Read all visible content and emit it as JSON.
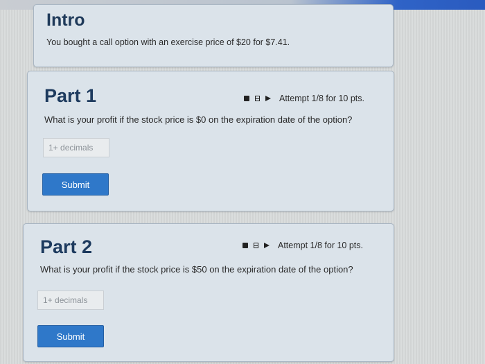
{
  "intro": {
    "title": "Intro",
    "text": "You bought a call option with an exercise price of $20 for $7.41."
  },
  "parts": [
    {
      "title": "Part 1",
      "attempt": "Attempt 1/8 for 10 pts.",
      "question": "What is your profit if the stock price is $0 on the expiration date of the option?",
      "input_placeholder": "1+ decimals",
      "input_value": "",
      "submit_label": "Submit"
    },
    {
      "title": "Part 2",
      "attempt": "Attempt 1/8 for 10 pts.",
      "question": "What is your profit if the stock price is $50 on the expiration date of the option?",
      "input_placeholder": "1+ decimals",
      "input_value": "",
      "submit_label": "Submit"
    }
  ],
  "icons": [
    "calculator-icon",
    "notes-icon",
    "flag-icon"
  ],
  "colors": {
    "accent": "#2f78c9",
    "heading": "#1d3a5e",
    "card_background": "#dbe3ea",
    "top_bar": "#2a5bbf"
  }
}
